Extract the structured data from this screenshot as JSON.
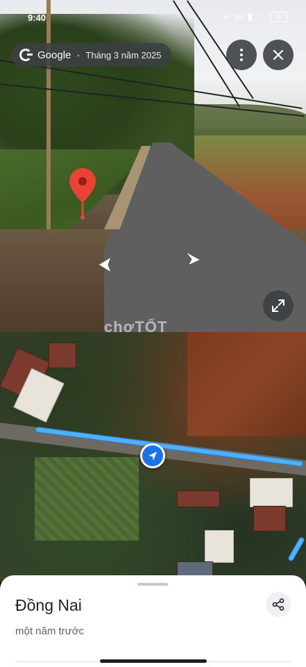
{
  "status_bar": {
    "time": "9:40",
    "network": "5G",
    "battery": "6"
  },
  "header": {
    "brand": "Google",
    "capture_date": "Tháng 3 năm 2025"
  },
  "watermark": "chợTỐT",
  "place": {
    "title": "Đồng Nai",
    "subtitle": "một năm trước"
  },
  "colors": {
    "route": "#4fb0ff",
    "location_marker": "#1a73e8",
    "pin": "#ea4335"
  },
  "icons": [
    "more-vert-icon",
    "close-icon",
    "expand-icon",
    "share-icon",
    "nav-arrow-left-icon",
    "nav-arrow-right-icon",
    "location-pin-icon",
    "navigation-arrow-icon"
  ]
}
